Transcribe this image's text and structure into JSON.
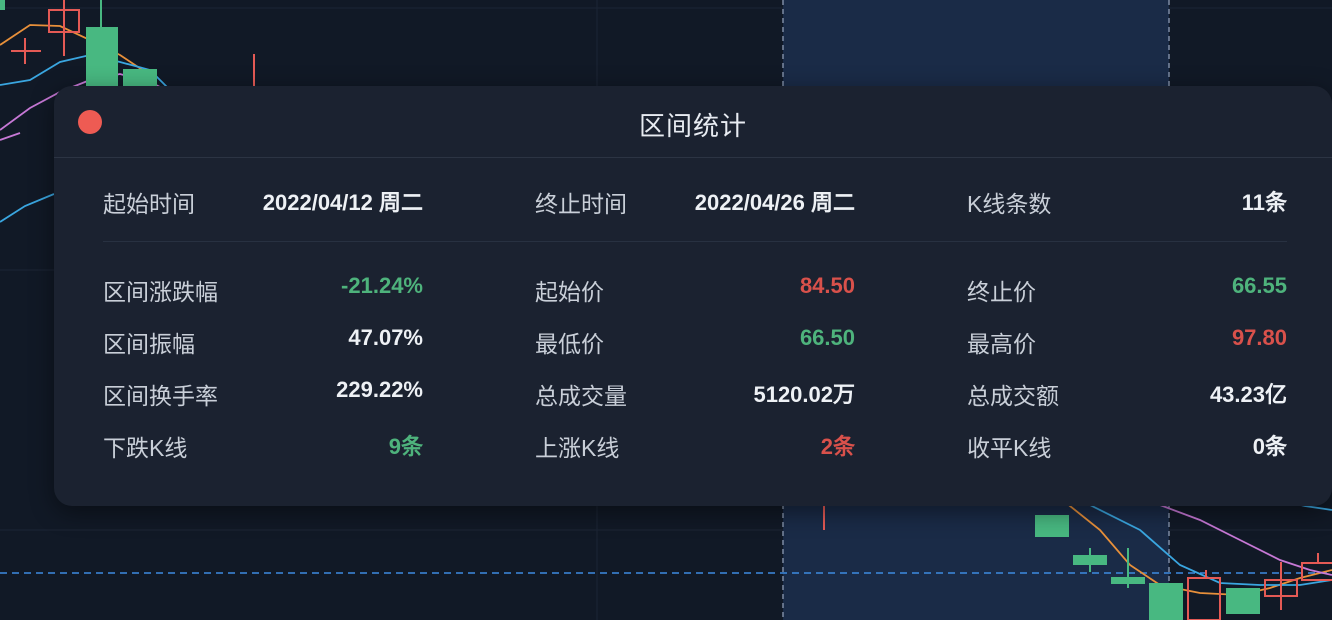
{
  "chart": {
    "colors": {
      "background": "#111926",
      "grid": "#1c2535",
      "selection": "#1a2b47",
      "up": "#e45a55",
      "down": "#48b881",
      "ma_orange": "#e8903a",
      "ma_blue": "#3aa6e0",
      "ma_purple": "#c778d6",
      "price_line": "#3d8be0"
    }
  },
  "panel": {
    "title": "区间统计",
    "close_icon": "close-dot-icon"
  },
  "range": {
    "start_label": "起始时间",
    "start_value": "2022/04/12 周二",
    "end_label": "终止时间",
    "end_value": "2022/04/26 周二",
    "count_label": "K线条数",
    "count_value": "11条"
  },
  "stats": [
    [
      {
        "label": "区间涨跌幅",
        "value": "-21.24%",
        "tone": "down"
      },
      {
        "label": "起始价",
        "value": "84.50",
        "tone": "up"
      },
      {
        "label": "终止价",
        "value": "66.55",
        "tone": "down"
      }
    ],
    [
      {
        "label": "区间振幅",
        "value": "47.07%",
        "tone": "neutral"
      },
      {
        "label": "最低价",
        "value": "66.50",
        "tone": "down"
      },
      {
        "label": "最高价",
        "value": "97.80",
        "tone": "up"
      }
    ],
    [
      {
        "label": "区间换手率",
        "value": "229.22%",
        "tone": "neutral"
      },
      {
        "label": "总成交量",
        "value": "5120.02万",
        "tone": "neutral"
      },
      {
        "label": "总成交额",
        "value": "43.23亿",
        "tone": "neutral"
      }
    ],
    [
      {
        "label": "下跌K线",
        "value": "9条",
        "tone": "down"
      },
      {
        "label": "上涨K线",
        "value": "2条",
        "tone": "up"
      },
      {
        "label": "收平K线",
        "value": "0条",
        "tone": "neutral"
      }
    ]
  ]
}
